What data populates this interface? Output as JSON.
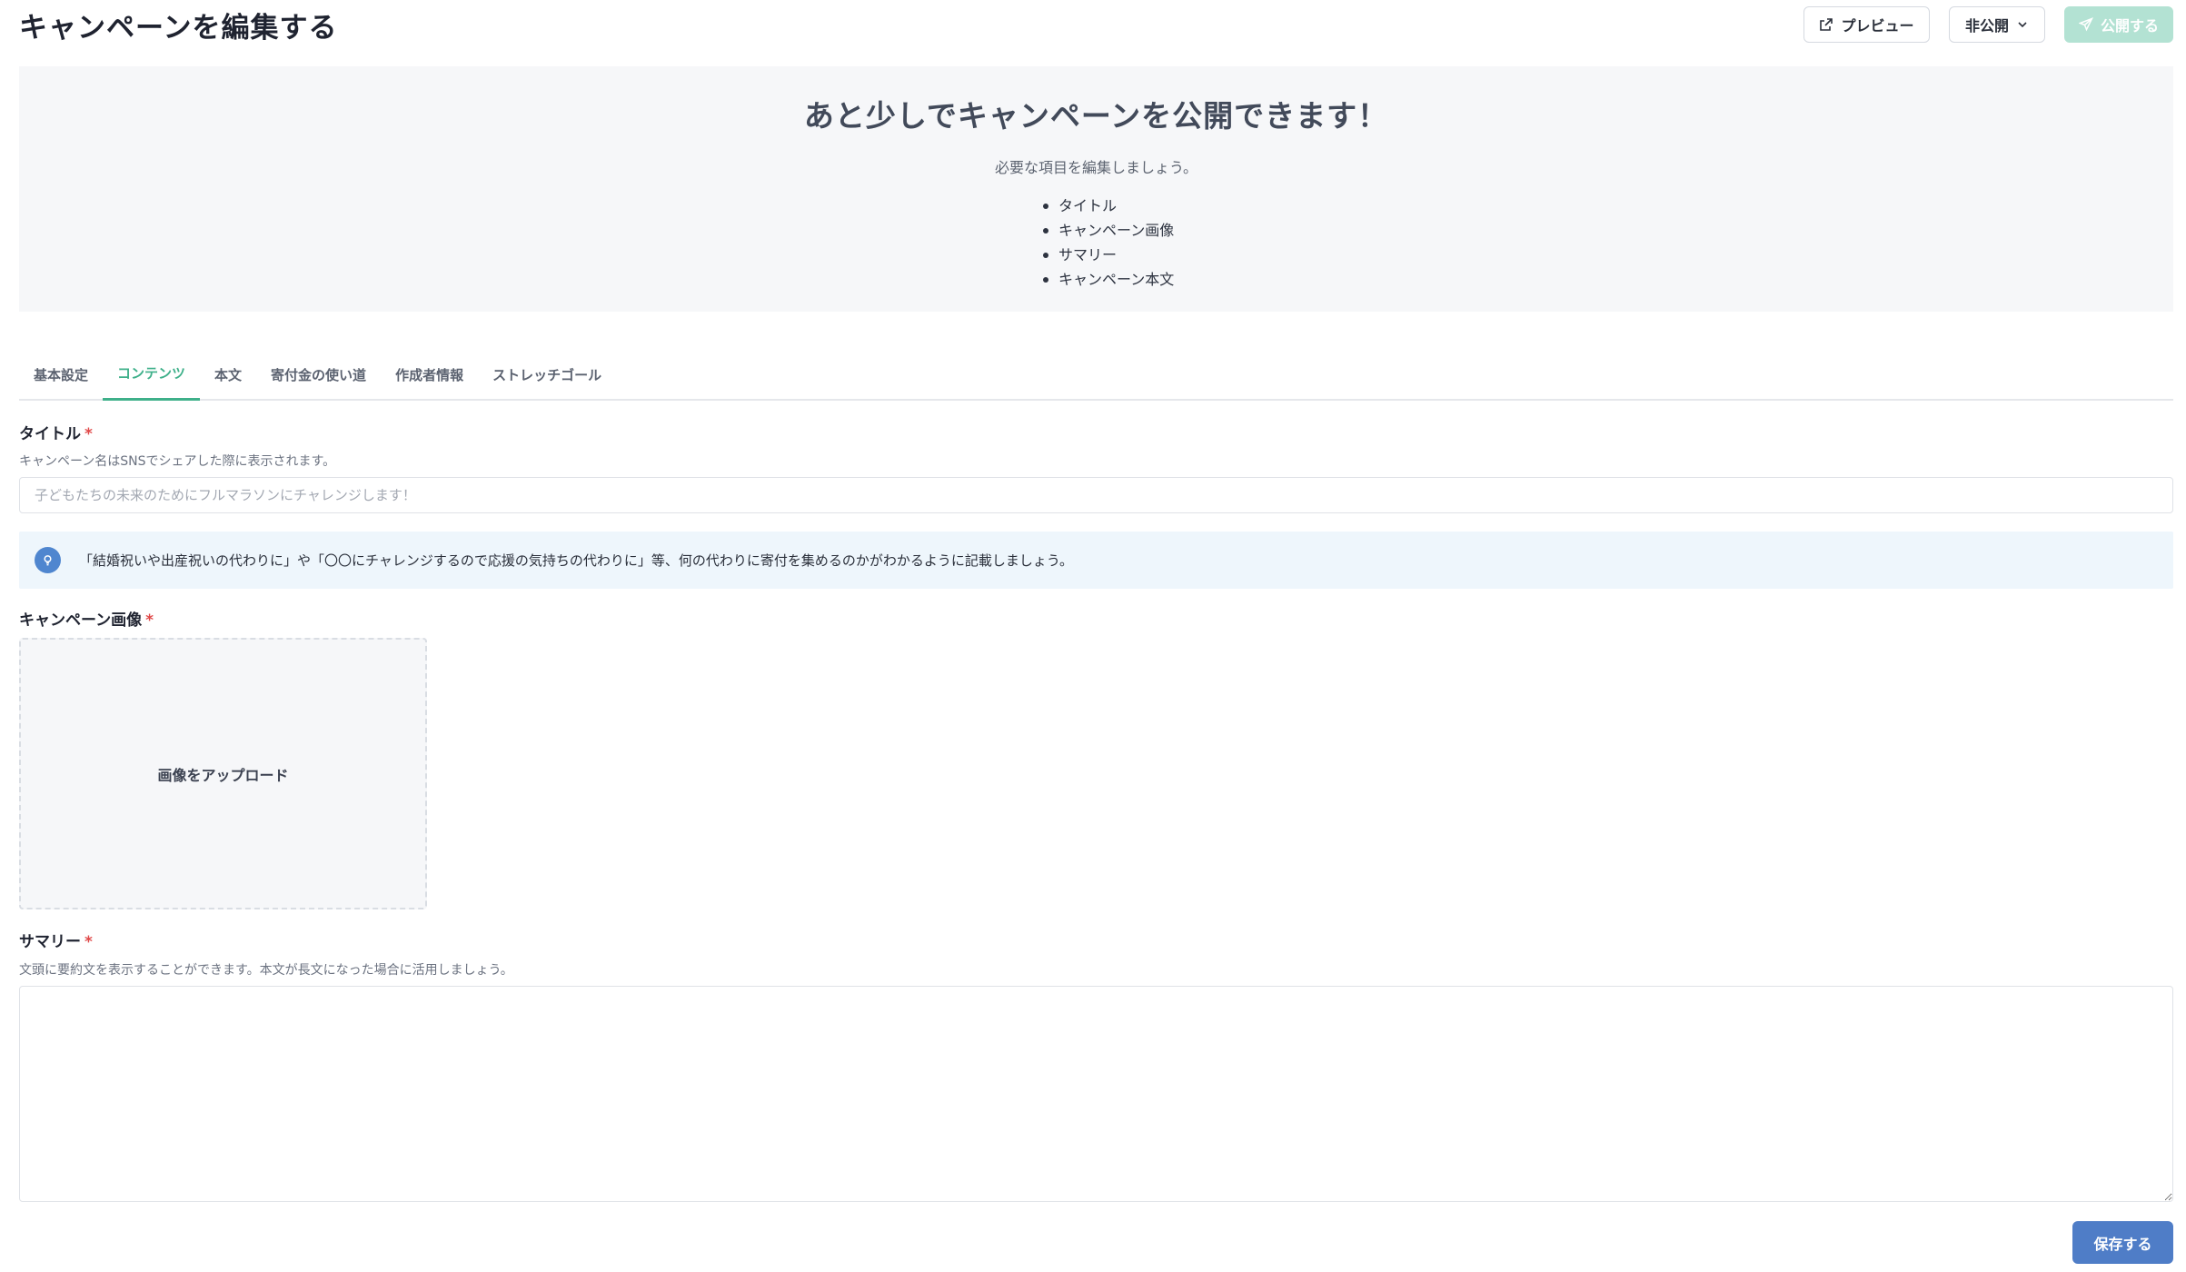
{
  "header": {
    "title": "キャンペーンを編集する",
    "preview_label": "プレビュー",
    "visibility_label": "非公開",
    "publish_label": "公開する"
  },
  "banner": {
    "title": "あと少しでキャンペーンを公開できます！",
    "subtitle": "必要な項目を編集しましょう。",
    "items": [
      "タイトル",
      "キャンペーン画像",
      "サマリー",
      "キャンペーン本文"
    ]
  },
  "tabs": [
    {
      "label": "基本設定",
      "active": false
    },
    {
      "label": "コンテンツ",
      "active": true
    },
    {
      "label": "本文",
      "active": false
    },
    {
      "label": "寄付金の使い道",
      "active": false
    },
    {
      "label": "作成者情報",
      "active": false
    },
    {
      "label": "ストレッチゴール",
      "active": false
    }
  ],
  "title_field": {
    "label": "タイトル",
    "required_mark": "*",
    "help": "キャンペーン名はSNSでシェアした際に表示されます。",
    "value": "",
    "placeholder": "子どもたちの未来のためにフルマラソンにチャレンジします！"
  },
  "tip": {
    "text": "「結婚祝いや出産祝いの代わりに」や「〇〇にチャレンジするので応援の気持ちの代わりに」等、何の代わりに寄付を集めるのかがわかるように記載しましょう。"
  },
  "image_field": {
    "label": "キャンペーン画像",
    "required_mark": "*",
    "upload_label": "画像をアップロード"
  },
  "summary_field": {
    "label": "サマリー",
    "required_mark": "*",
    "help": "文頭に要約文を表示することができます。本文が長文になった場合に活用しましょう。",
    "value": ""
  },
  "footer": {
    "save_label": "保存する"
  },
  "colors": {
    "accent": "#3fb08a",
    "publish_disabled": "#b3e2d3",
    "primary_button": "#4f7dc7",
    "tip_background": "#eef6fc",
    "required": "#e04848"
  }
}
